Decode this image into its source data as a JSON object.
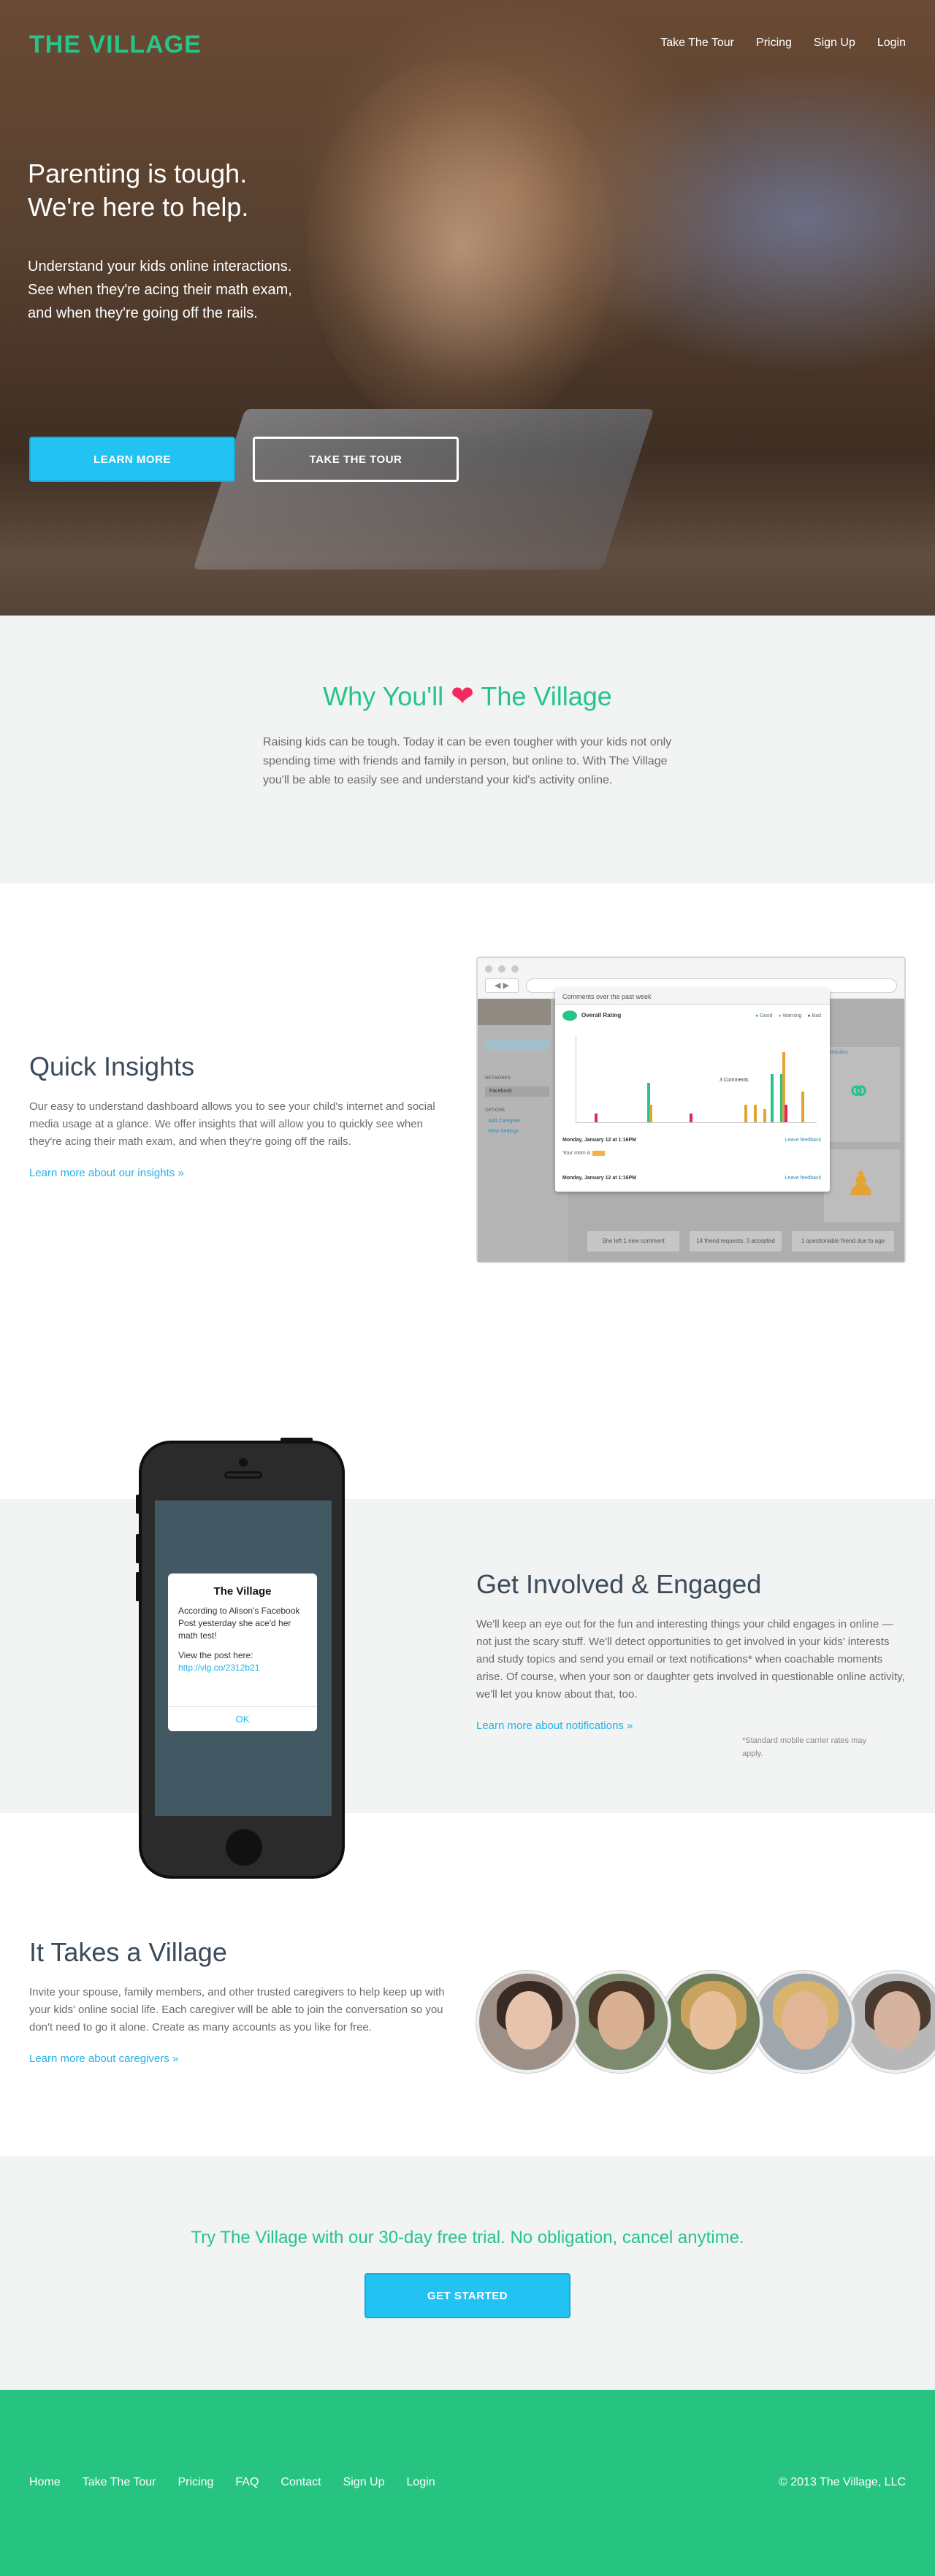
{
  "brand": {
    "logo": "THE VILLAGE",
    "accent": "#27c48a",
    "link_color": "#22b3e6",
    "button_color": "#22c3f2",
    "heart_color": "#f2295f"
  },
  "nav": {
    "items": [
      "Take The Tour",
      "Pricing",
      "Sign Up",
      "Login"
    ]
  },
  "hero": {
    "title_line1": "Parenting is tough.",
    "title_line2": "We're here to help.",
    "sub_line1": "Understand your kids online interactions.",
    "sub_line2": "See when they're acing their math exam,",
    "sub_line3": "and when they're going off the rails.",
    "learn_more": "LEARN MORE",
    "take_tour": "TAKE THE TOUR"
  },
  "why": {
    "title_before": "Why You'll",
    "title_after": "The Village",
    "heart_icon": "heart-icon",
    "body": "Raising kids can be tough. Today it can be even tougher with your kids not only spending time with friends and family in person, but online to. With The Village you'll be able to easily see and understand your kid's activity online."
  },
  "insights": {
    "title": "Quick Insights",
    "body": "Our easy to understand dashboard allows you to see your child's internet and social media usage at a glance. We offer insights that will allow you to quickly see when they're acing their math exam, and when they're going off the rails.",
    "link": "Learn more about our insights »",
    "screenshot": {
      "modal_header": "Comments over the past week",
      "chart_title": "Overall Rating",
      "legend": [
        "Good",
        "Warning",
        "Bad"
      ],
      "comments_label": "3 Comments",
      "date1": "Monday, January 12 at 1:16PM",
      "date2": "Monday, January 12 at 1:16PM",
      "leave_feedback": "Leave feedback",
      "your_mom": "Your mom is",
      "stat1": "She left 1 new comment",
      "stat2": "14 friend requests, 3 accepted",
      "stat3": "1 questionable friend due to age",
      "sidebar_networks": "NETWORKS",
      "sidebar_facebook": "Facebook",
      "sidebar_options": "OPTIONS",
      "sidebar_add": "Add Caregiver",
      "sidebar_settings": "View Settings",
      "websites_label": "Websites",
      "bars": {
        "good": [
          0,
          0,
          0,
          0,
          0,
          0,
          0,
          0.45,
          0,
          0,
          0,
          0,
          0,
          0,
          0,
          0,
          0,
          0,
          0,
          0,
          0.55,
          0.55,
          0,
          0
        ],
        "warning": [
          0,
          0,
          0,
          0,
          0,
          0,
          0,
          0.2,
          0,
          0,
          0,
          0,
          0,
          0,
          0,
          0,
          0,
          0.2,
          0.2,
          0.15,
          0,
          0.8,
          0,
          0.35
        ],
        "bad": [
          0,
          0.1,
          0,
          0,
          0,
          0,
          0,
          0,
          0,
          0,
          0,
          0.1,
          0,
          0,
          0,
          0,
          0,
          0,
          0,
          0,
          0,
          0.2,
          0,
          0
        ]
      }
    }
  },
  "involved": {
    "title": "Get Involved & Engaged",
    "body": "We'll keep an eye out for the fun and interesting things your child engages in online — not just the scary stuff. We'll detect opportunities to get involved in your kids' interests and study topics and send you email or text notifications* when coachable moments arise. Of course, when your son or daughter gets involved in questionable online activity, we'll let you know about that, too.",
    "link": "Learn more about notifications »",
    "note": "*Standard mobile carrier rates may apply.",
    "alert_title": "The Village",
    "alert_line1": "According to Alison's Facebook Post yesterday she ace'd her math test!",
    "alert_line2_prefix": "View the post here: ",
    "alert_link": "http://vlg.co/2312b21",
    "alert_ok": "OK"
  },
  "village": {
    "title": "It Takes a Village",
    "body": "Invite your spouse, family members, and other trusted caregivers to help keep up with your kids' online social life. Each caregiver will be able to join the conversation so you don't need to go it alone. Create as many accounts as you like for free.",
    "link": "Learn more about caregivers »",
    "faces": [
      {
        "skin": "#e7c3ac",
        "hair": "#3a2a24",
        "bg": "#9d8f86"
      },
      {
        "skin": "#d9b092",
        "hair": "#4b3526",
        "bg": "#7e8a6e"
      },
      {
        "skin": "#e6bf9a",
        "hair": "#c9a25d",
        "bg": "#6e7c58"
      },
      {
        "skin": "#e2b596",
        "hair": "#d8b46c",
        "bg": "#9fa7ad"
      },
      {
        "skin": "#d6b39e",
        "hair": "#4a3a30",
        "bg": "#b7b7b7"
      }
    ]
  },
  "cta": {
    "line": "Try The Village with our 30-day free trial. No obligation, cancel anytime.",
    "button": "GET STARTED"
  },
  "footer": {
    "links": [
      "Home",
      "Take The Tour",
      "Pricing",
      "FAQ",
      "Contact",
      "Sign Up",
      "Login"
    ],
    "copyright": "© 2013 The Village, LLC"
  }
}
